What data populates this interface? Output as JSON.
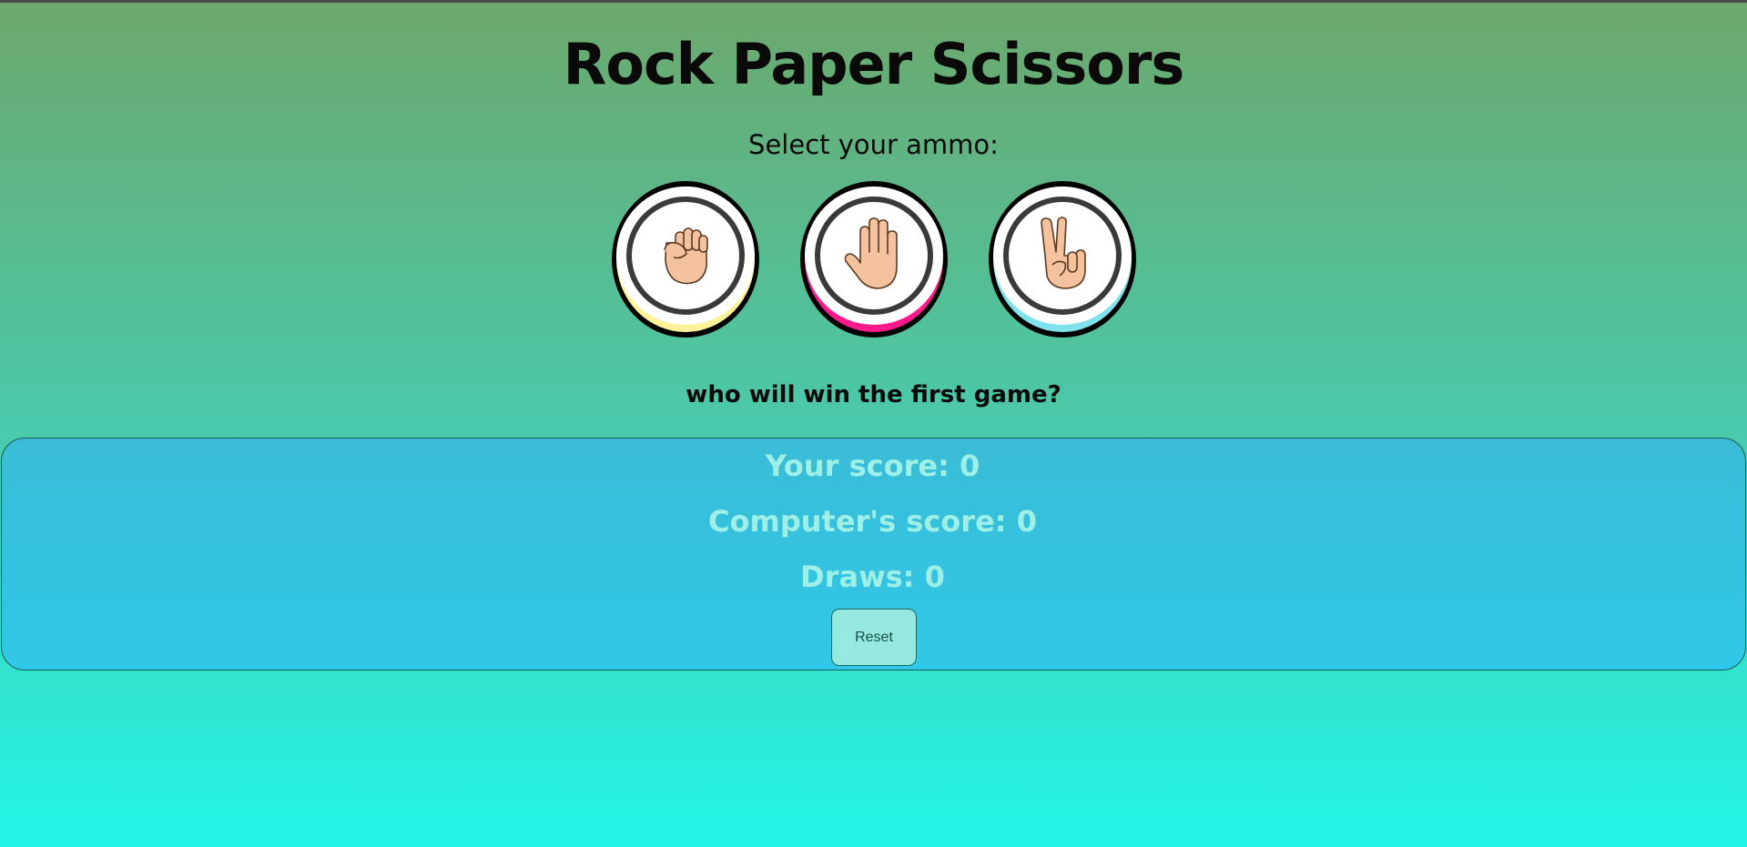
{
  "game": {
    "title": "Rock Paper Scissors",
    "prompt": "Select your ammo:",
    "status": "who will win the first game?"
  },
  "choices": [
    {
      "name": "rock",
      "icon": "fist-icon",
      "accent": "#fff29a"
    },
    {
      "name": "paper",
      "icon": "open-hand-icon",
      "accent": "#ff1a8c"
    },
    {
      "name": "scissors",
      "icon": "victory-hand-icon",
      "accent": "#7fe3ec"
    }
  ],
  "scoreboard": {
    "player_score": "Your score: 0",
    "computer_score": "Computer's score: 0",
    "draws": "Draws: 0",
    "reset_label": "Reset"
  },
  "colors": {
    "skin": "#f4c29e",
    "outline": "#5a3a22"
  }
}
